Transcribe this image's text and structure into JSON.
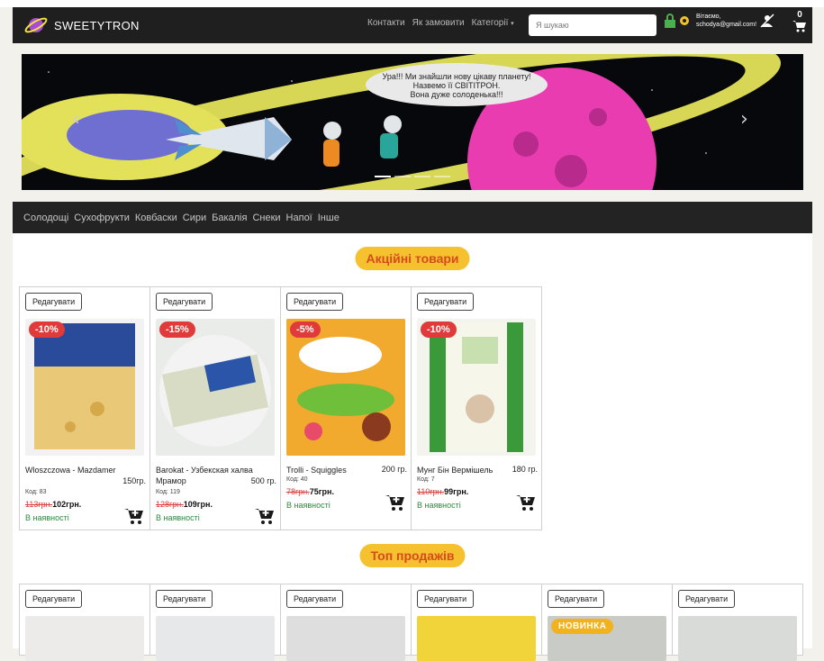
{
  "brand": {
    "name": "SWEETYTRON"
  },
  "nav": {
    "links": [
      "Контакти",
      "Як замовити",
      "Категорії"
    ],
    "search_placeholder": "Я шукаю"
  },
  "user": {
    "greeting": "Вітаємо,",
    "email": "schodya@gmail.com!"
  },
  "cart": {
    "count": "0"
  },
  "banner": {
    "speech": [
      "Ура!!! Ми знайшли нову цікаву планету!",
      "Назвемо її СВІТІТРОН.",
      "Вона дуже солоденька!!!"
    ],
    "slides": 4,
    "active_slide": 0
  },
  "categories": [
    "Солодощі",
    "Сухофрукти",
    "Ковбаски",
    "Сири",
    "Бакалія",
    "Снеки",
    "Напої",
    "Інше"
  ],
  "sections": {
    "promo_title": "Акційні товари",
    "top_title": "Топ продажів"
  },
  "labels": {
    "edit": "Редагувати",
    "in_stock": "В наявності",
    "new_badge": "НОВИНКА"
  },
  "promo_products": [
    {
      "discount": "-10%",
      "name": "Wloszczowa - Mazdamer",
      "weight": "150гр.",
      "code": "Код: 83",
      "old_price": "113грн.",
      "new_price": "102грн."
    },
    {
      "discount": "-15%",
      "name": "Barokat - Узбекская халва Мрамор",
      "weight": "500 гр.",
      "code": "Код: 119",
      "old_price": "128грн.",
      "new_price": "109грн."
    },
    {
      "discount": "-5%",
      "name": "Trolli - Squiggles",
      "weight": "200 гр.",
      "code": "Код: 40",
      "old_price": "78грн.",
      "new_price": "75грн."
    },
    {
      "discount": "-10%",
      "name": "Мунг Бін Вермішель",
      "weight": "180 гр.",
      "code": "Код: 7",
      "old_price": "110грн.",
      "new_price": "99грн."
    }
  ],
  "colors": {
    "navbar": "#1f1f1f",
    "accent_pill": "#f6c12f",
    "pill_text": "#d84a1c",
    "discount": "#e03a3a",
    "stock": "#2a8a3a"
  }
}
